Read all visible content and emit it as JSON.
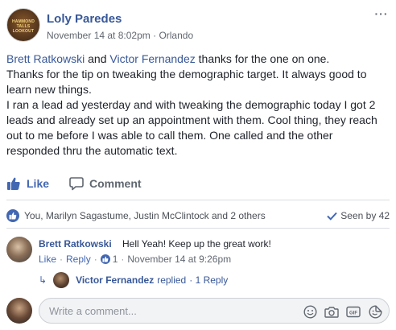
{
  "post": {
    "author": "Loly Paredes",
    "date": "November 14 at 8:02pm",
    "separator": "·",
    "location": "Orlando",
    "avatar_logo_text": "HAMMOND TALLS LOOKOUT",
    "more": "···",
    "body": {
      "mention1": "Brett Ratkowski",
      "and": " and ",
      "mention2": "Victor Fernandez",
      "line1_rest": " thanks for the one on one.",
      "paragraph2": "Thanks for the tip on tweaking the demographic target. It always good to learn new things.",
      "paragraph3": "I ran a lead ad yesterday and with tweaking the demographic today I got 2 leads and already set up an appointment with them. Cool thing, they reach out to me before I was able to call them. One called and the other responded thru the automatic text."
    }
  },
  "actions": {
    "like": "Like",
    "comment": "Comment"
  },
  "reactions": {
    "names": "You, Marilyn Sagastume, Justin McClintock and 2 others",
    "seen_by": "Seen by 42"
  },
  "comment": {
    "author": "Brett Ratkowski",
    "text": "Hell Yeah! Keep up the great work!",
    "like": "Like",
    "reply": "Reply",
    "sep": "·",
    "like_count": "1",
    "time": "November 14 at 9:26pm",
    "reply_summary": {
      "author": "Victor Fernandez",
      "text": "replied",
      "count": "· 1 Reply"
    }
  },
  "write_comment": {
    "placeholder": "Write a comment..."
  },
  "colors": {
    "link": "#385898",
    "accent": "#4267b2",
    "muted": "#616770"
  }
}
